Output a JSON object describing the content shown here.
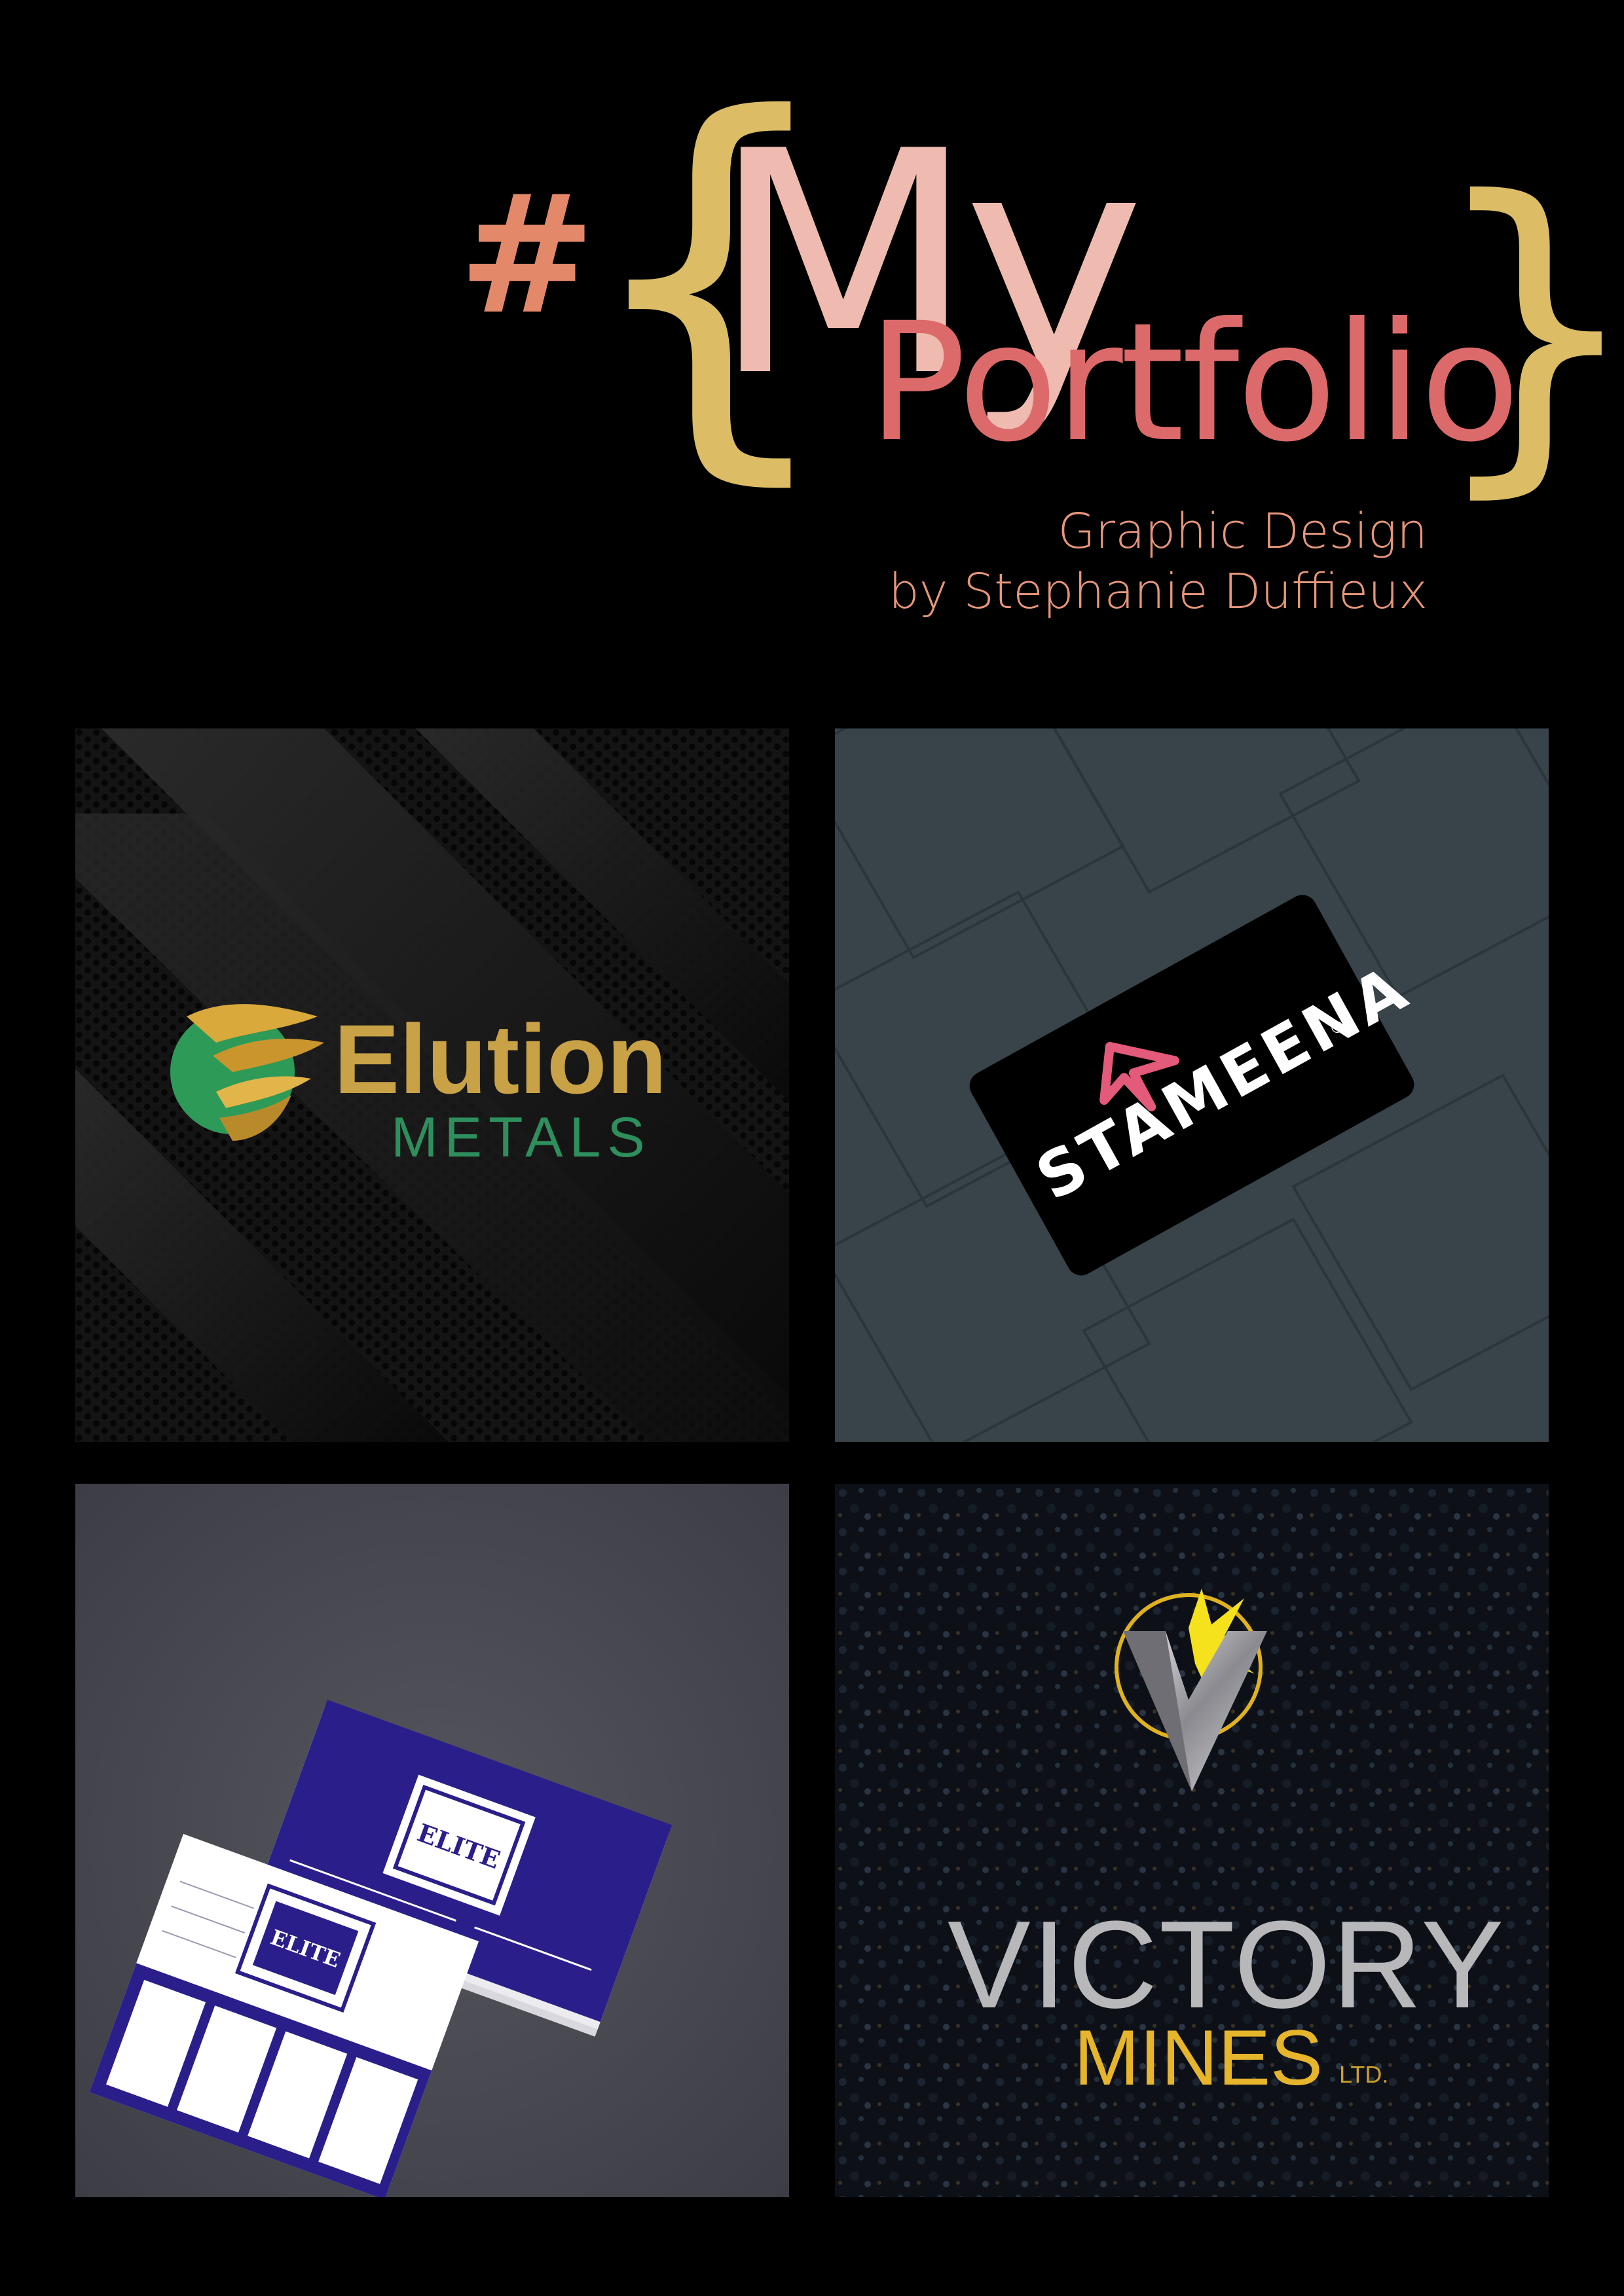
{
  "header": {
    "hash": "#",
    "brace_open": "{",
    "brace_close": "}",
    "title_my": "My",
    "title_portfolio": "Portfolio",
    "subtitle_line1": "Graphic Design",
    "subtitle_line2": "by Stephanie Duffieux"
  },
  "colors": {
    "background": "#000000",
    "brace": "#dcbd66",
    "hash": "#e4886a",
    "my": "#efbbb0",
    "portfolio": "#dd6a6a",
    "subtitle": "#e6967b"
  },
  "tiles": [
    {
      "id": "elution",
      "name": "Elution",
      "sub": "METALS"
    },
    {
      "id": "stameena",
      "name": "STAMEENA",
      "mark": "®"
    },
    {
      "id": "elite",
      "card_text": "ELITE"
    },
    {
      "id": "victory",
      "name": "VICTORY",
      "sub": "MINES",
      "suffix": "LTD."
    }
  ]
}
